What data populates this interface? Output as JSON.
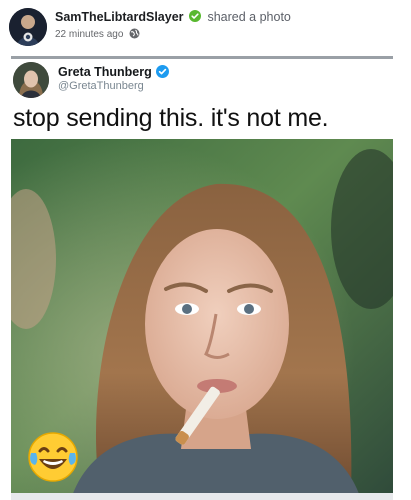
{
  "post": {
    "author": "SamTheLibtardSlayer",
    "action": "shared a photo",
    "timestamp": "22 minutes ago",
    "icons": {
      "avatar": "profile-avatar",
      "verified": "green-check-badge-icon",
      "privacy": "globe-icon"
    },
    "colors": {
      "badge": "#58b82f",
      "meta": "#65676b"
    }
  },
  "tweet": {
    "name": "Greta Thunberg",
    "handle": "@GretaThunberg",
    "text": "stop sending this. it's not me.",
    "icons": {
      "verified": "blue-verified-badge-icon"
    },
    "colors": {
      "verified": "#1d9bf0"
    }
  },
  "image": {
    "reaction": "laughing-crying-emoji"
  }
}
